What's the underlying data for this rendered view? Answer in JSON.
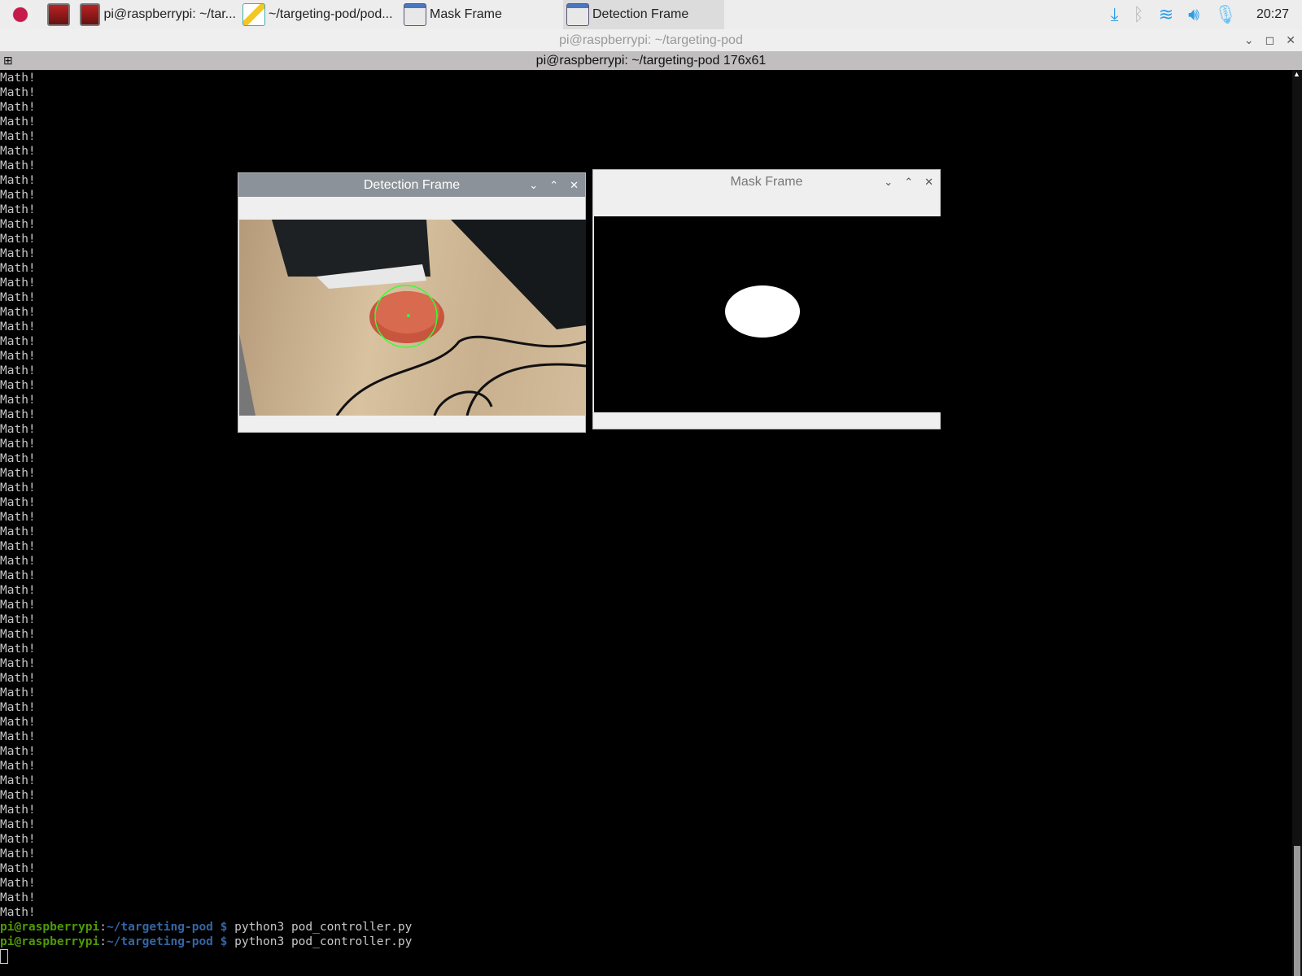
{
  "taskbar": {
    "items": [
      {
        "label": "",
        "icon": "terminal-icon"
      },
      {
        "label": "pi@raspberrypi: ~/tar...",
        "icon": "terminal-icon"
      },
      {
        "label": "~/targeting-pod/pod...",
        "icon": "text-editor-icon"
      },
      {
        "label": "Mask Frame",
        "icon": "window-icon"
      },
      {
        "label": "Detection Frame",
        "icon": "window-icon"
      }
    ],
    "clock": "20:27"
  },
  "window": {
    "title": "pi@raspberrypi: ~/targeting-pod",
    "tab_title": "pi@raspberrypi: ~/targeting-pod 176x61"
  },
  "terminal": {
    "repeated_line": "Math!",
    "repeat_count": 58,
    "prompt_user": "pi@raspberrypi",
    "prompt_path": "~/targeting-pod",
    "prompt_sep": ":",
    "prompt_dollar": " $ ",
    "command": "python3 pod_controller.py"
  },
  "detection_window": {
    "title": "Detection Frame"
  },
  "mask_window": {
    "title": "Mask Frame"
  },
  "colors": {
    "tray_blue": "#2a9de8",
    "prompt_green": "#4e9a06",
    "prompt_blue": "#3465a4"
  }
}
